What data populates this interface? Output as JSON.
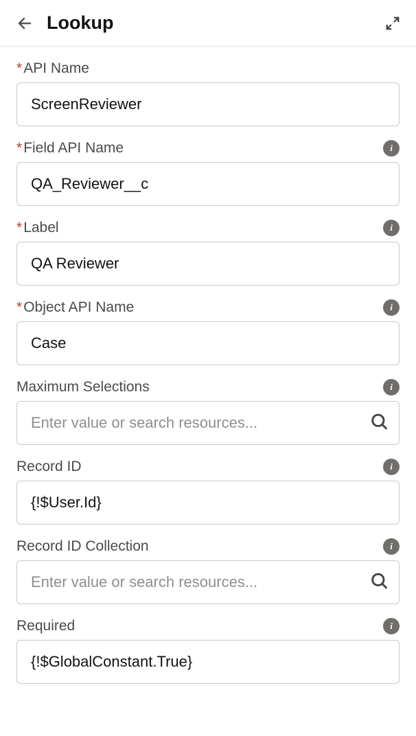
{
  "header": {
    "title": "Lookup"
  },
  "fields": {
    "apiName": {
      "label": "API Name",
      "value": "ScreenReviewer",
      "required": true
    },
    "fieldApiName": {
      "label": "Field API Name",
      "value": "QA_Reviewer__c",
      "required": true
    },
    "label": {
      "label": "Label",
      "value": "QA Reviewer",
      "required": true
    },
    "objectApiName": {
      "label": "Object API Name",
      "value": "Case",
      "required": true
    },
    "maxSelections": {
      "label": "Maximum Selections",
      "placeholder": "Enter value or search resources...",
      "value": "",
      "required": false
    },
    "recordId": {
      "label": "Record ID",
      "value": "{!$User.Id}",
      "required": false
    },
    "recordIdCollection": {
      "label": "Record ID Collection",
      "placeholder": "Enter value or search resources...",
      "value": "",
      "required": false
    },
    "required": {
      "label": "Required",
      "value": "{!$GlobalConstant.True}",
      "required": false
    }
  }
}
